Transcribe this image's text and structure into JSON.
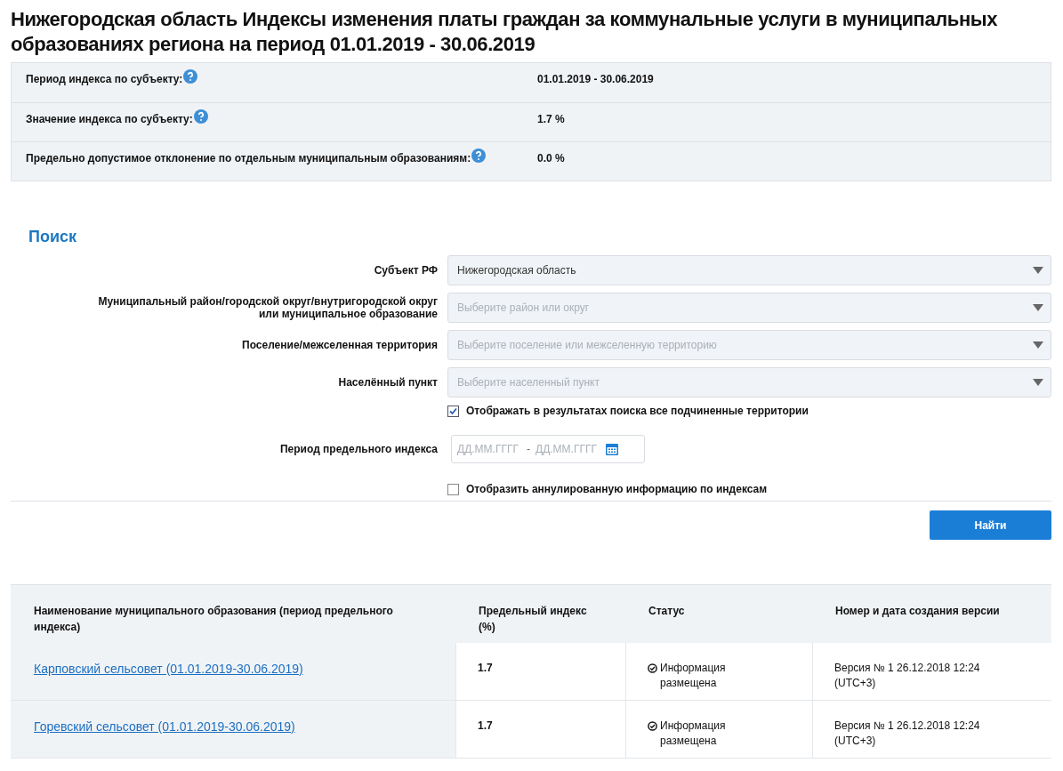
{
  "title": "Нижегородская область Индексы изменения платы граждан за коммунальные услуги в муниципальных образованиях региона на период 01.01.2019 - 30.06.2019",
  "summary": [
    {
      "label": "Период индекса по субъекту:",
      "value": "01.01.2019 - 30.06.2019"
    },
    {
      "label": "Значение индекса по субъекту:",
      "value": "1.7 %"
    },
    {
      "label": "Предельно допустимое отклонение по отдельным муниципальным образованиям:",
      "value": "0.0 %"
    }
  ],
  "search": {
    "heading": "Поиск",
    "selects": [
      {
        "label": "Субъект РФ",
        "value": "Нижегородская область"
      },
      {
        "label": "Муниципальный район/городской округ/внутригородской округ или муниципальное образование",
        "placeholder": "Выберите район или округ"
      },
      {
        "label": "Поселение/межселенная территория",
        "placeholder": "Выберите поселение или межселенную территорию"
      },
      {
        "label": "Населённый пункт",
        "placeholder": "Выберите населенный пункт"
      }
    ],
    "show_subordinate": {
      "label": "Отображать в результатах поиска все подчиненные территории",
      "checked": true
    },
    "period": {
      "label": "Период предельного индекса",
      "from_placeholder": "ДД.ММ.ГГГГ",
      "separator": "-",
      "to_placeholder": "ДД.ММ.ГГГГ"
    },
    "show_cancelled": {
      "label": "Отобразить аннулированную информацию по индексам",
      "checked": false
    },
    "button": "Найти"
  },
  "table": {
    "columns": [
      "Наименование муниципального образования (период предельного индекса)",
      "Предельный индекс (%)",
      "Статус",
      "Номер и дата создания версии"
    ],
    "rows": [
      {
        "name": "Карповский сельсовет (01.01.2019-30.06.2019)",
        "index": "1.7",
        "status": "Информация размещена",
        "version": "Версия № 1 26.12.2018 12:24 (UTC+3)"
      },
      {
        "name": "Горевский сельсовет (01.01.2019-30.06.2019)",
        "index": "1.7",
        "status": "Информация размещена",
        "version": "Версия № 1 26.12.2018 12:24 (UTC+3)"
      }
    ]
  }
}
